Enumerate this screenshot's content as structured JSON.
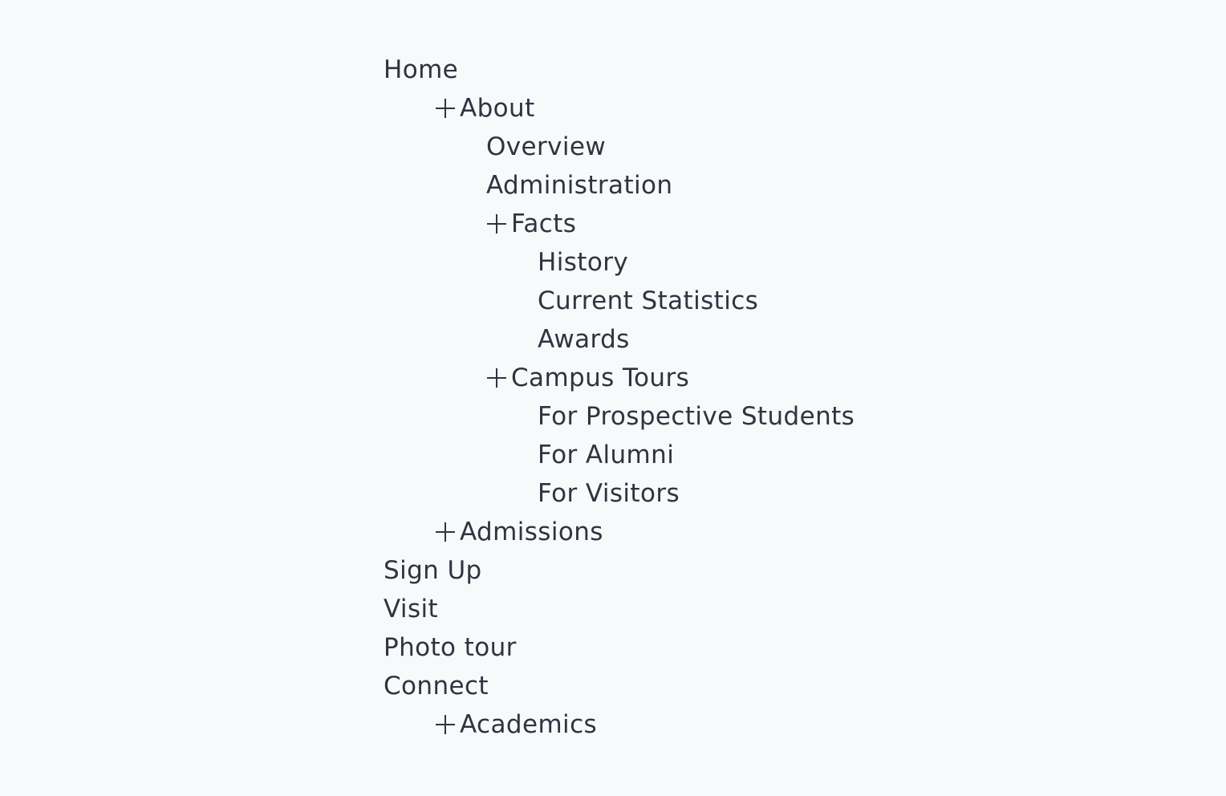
{
  "nav": {
    "items": [
      {
        "label": "Home",
        "level": 0,
        "expander": false
      },
      {
        "label": "About",
        "level": 1,
        "expander": true
      },
      {
        "label": "Overview",
        "level": 2,
        "expander": false
      },
      {
        "label": "Administration",
        "level": 2,
        "expander": false
      },
      {
        "label": "Facts",
        "level": 2,
        "expander": true
      },
      {
        "label": "History",
        "level": 3,
        "expander": false
      },
      {
        "label": "Current Statistics",
        "level": 3,
        "expander": false
      },
      {
        "label": "Awards",
        "level": 3,
        "expander": false
      },
      {
        "label": "Campus Tours",
        "level": 2,
        "expander": true
      },
      {
        "label": "For Prospective Students",
        "level": 3,
        "expander": false
      },
      {
        "label": "For Alumni",
        "level": 3,
        "expander": false
      },
      {
        "label": "For Visitors",
        "level": 3,
        "expander": false
      },
      {
        "label": "Admissions",
        "level": 1,
        "expander": true
      },
      {
        "label": "Sign Up",
        "level": 0,
        "expander": false
      },
      {
        "label": "Visit",
        "level": 0,
        "expander": false
      },
      {
        "label": "Photo tour",
        "level": 0,
        "expander": false
      },
      {
        "label": "Connect",
        "level": 0,
        "expander": false
      },
      {
        "label": "Academics",
        "level": 1,
        "expander": true
      }
    ]
  },
  "colors": {
    "background": "#f8f9fa",
    "text": "#2e3440"
  },
  "icons": {
    "expander": "plus-icon"
  }
}
